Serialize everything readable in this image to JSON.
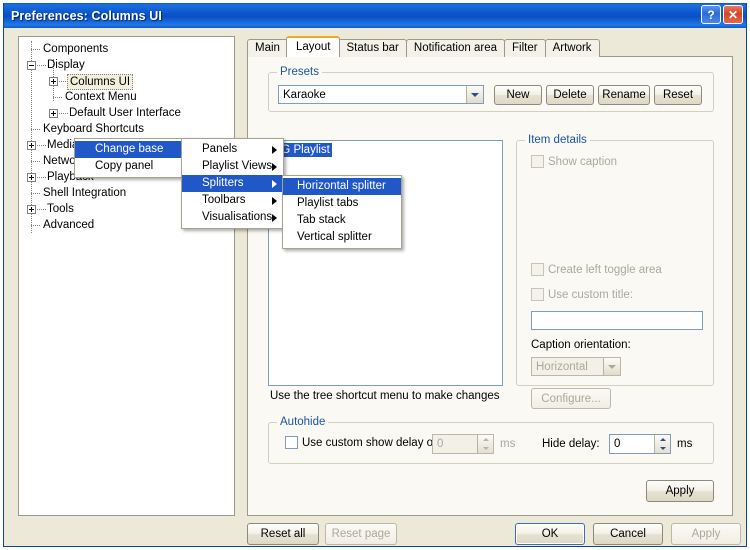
{
  "window": {
    "title": "Preferences: Columns UI",
    "help_button": "?",
    "close_button": "✕"
  },
  "tree": {
    "items": [
      {
        "label": "Components",
        "level": 1,
        "expander": "none"
      },
      {
        "label": "Display",
        "level": 1,
        "expander": "minus"
      },
      {
        "label": "Columns UI",
        "level": 2,
        "expander": "plus",
        "selected": true
      },
      {
        "label": "Context Menu",
        "level": 2,
        "expander": "none"
      },
      {
        "label": "Default User Interface",
        "level": 2,
        "expander": "plus"
      },
      {
        "label": "Keyboard Shortcuts",
        "level": 1,
        "expander": "none"
      },
      {
        "label": "Media Library",
        "level": 1,
        "expander": "plus"
      },
      {
        "label": "Networking",
        "level": 1,
        "expander": "none"
      },
      {
        "label": "Playback",
        "level": 1,
        "expander": "plus"
      },
      {
        "label": "Shell Integration",
        "level": 1,
        "expander": "none"
      },
      {
        "label": "Tools",
        "level": 1,
        "expander": "plus"
      },
      {
        "label": "Advanced",
        "level": 1,
        "expander": "none"
      }
    ]
  },
  "tabs": [
    {
      "label": "Main",
      "active": false
    },
    {
      "label": "Layout",
      "active": true
    },
    {
      "label": "Status bar",
      "active": false
    },
    {
      "label": "Notification area",
      "active": false
    },
    {
      "label": "Filter",
      "active": false
    },
    {
      "label": "Artwork",
      "active": false
    }
  ],
  "presets": {
    "legend": "Presets",
    "selected": "Karaoke",
    "buttons": [
      "New",
      "Delete",
      "Rename",
      "Reset"
    ]
  },
  "panel_tree": {
    "selected_item": "NG Playlist",
    "hint": "Use the tree shortcut menu to make changes"
  },
  "context_menu": {
    "items": [
      {
        "label": "Change base",
        "submenu": true,
        "highlighted": true
      },
      {
        "label": "Copy panel",
        "submenu": false,
        "highlighted": false
      }
    ]
  },
  "submenu": {
    "items": [
      {
        "label": "Panels",
        "submenu": true,
        "highlighted": false
      },
      {
        "label": "Playlist Views",
        "submenu": true,
        "highlighted": false
      },
      {
        "label": "Splitters",
        "submenu": true,
        "highlighted": true
      },
      {
        "label": "Toolbars",
        "submenu": true,
        "highlighted": false
      },
      {
        "label": "Visualisations",
        "submenu": true,
        "highlighted": false
      }
    ]
  },
  "submenu2": {
    "items": [
      {
        "label": "Horizontal splitter",
        "highlighted": true
      },
      {
        "label": "Playlist tabs",
        "highlighted": false
      },
      {
        "label": "Tab stack",
        "highlighted": false
      },
      {
        "label": "Vertical splitter",
        "highlighted": false
      }
    ]
  },
  "item_details": {
    "legend": "Item details",
    "show_caption": "Show caption",
    "create_left_toggle": "Create left toggle area",
    "use_custom_title": "Use custom title:",
    "custom_title_value": "",
    "caption_orientation_label": "Caption orientation:",
    "caption_orientation_value": "Horizontal",
    "configure_button": "Configure..."
  },
  "autohide": {
    "legend": "Autohide",
    "custom_show_delay": "Use custom show delay of",
    "show_delay_value": "0",
    "show_delay_unit": "ms",
    "hide_delay_label": "Hide delay:",
    "hide_delay_value": "0",
    "hide_delay_unit": "ms"
  },
  "tab_apply": "Apply",
  "bottom_buttons": {
    "reset_all": "Reset all",
    "reset_page": "Reset page",
    "ok": "OK",
    "cancel": "Cancel",
    "apply": "Apply"
  },
  "colors": {
    "titlebar_blue": "#0c56cc",
    "highlight_blue": "#2158c8",
    "legend_blue": "#1b54a6",
    "active_tab_accent": "#f5a623",
    "dialog_bg": "#ece9d8",
    "disabled_text": "#aca899"
  }
}
